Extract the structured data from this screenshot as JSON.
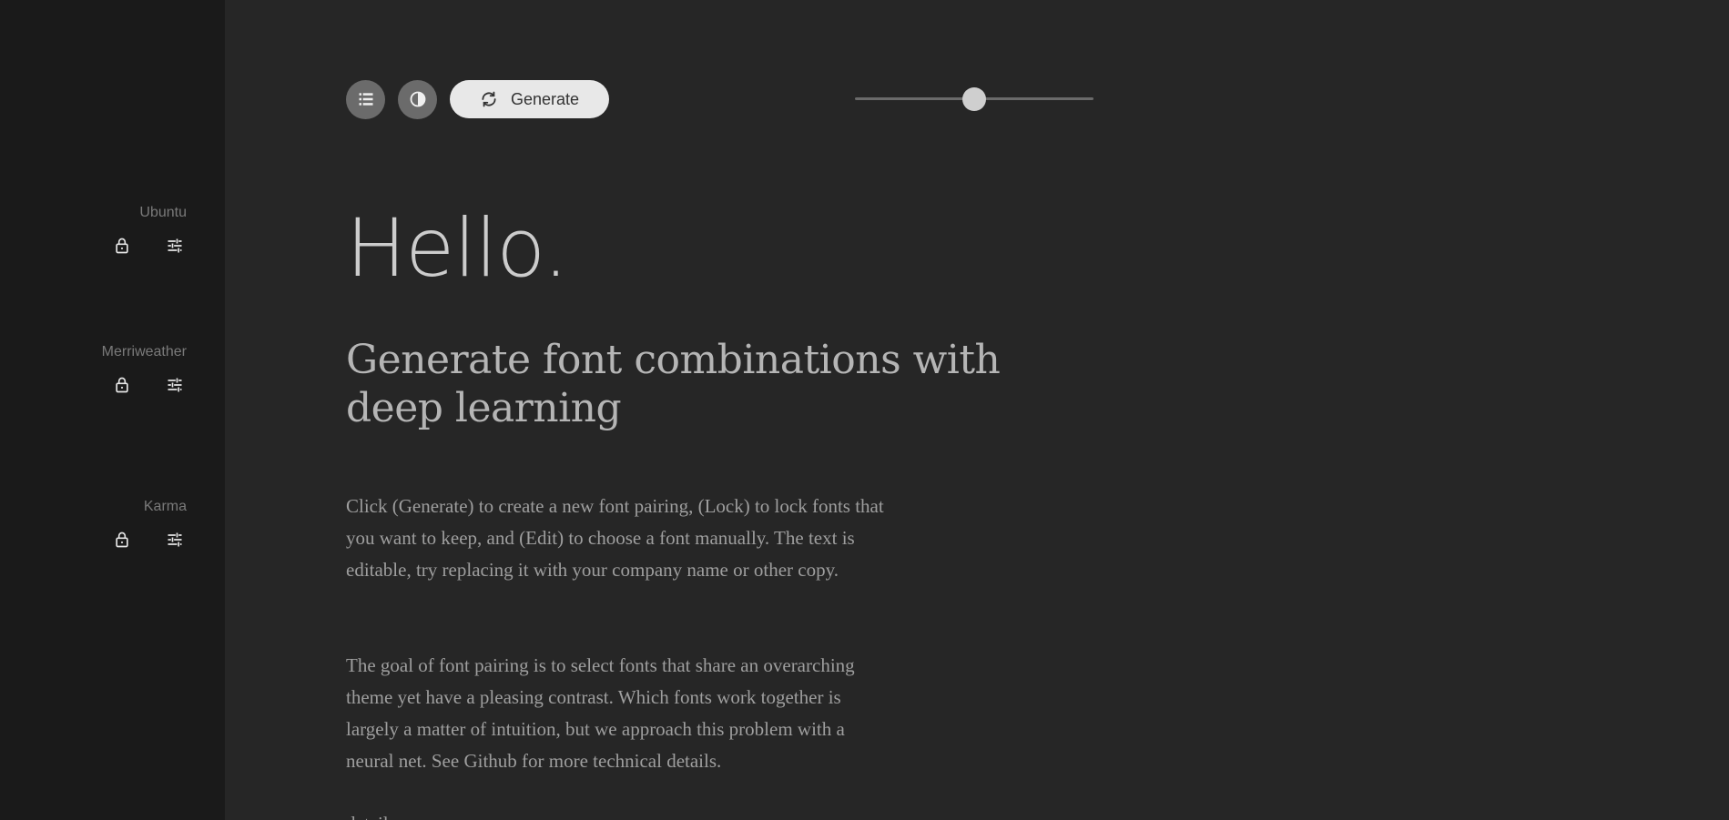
{
  "sidebar": {
    "fonts": [
      {
        "name": "Ubuntu"
      },
      {
        "name": "Merriweather"
      },
      {
        "name": "Karma"
      }
    ],
    "lock_icon": "lock-icon",
    "edit_icon": "sliders-icon"
  },
  "toolbar": {
    "list_icon": "list-icon",
    "contrast_icon": "contrast-icon",
    "generate_label": "Generate",
    "generate_icon": "refresh-icon",
    "slider_value": 0.5
  },
  "content": {
    "heading": "Hello.",
    "subtitle": "Generate font combinations with deep learning",
    "paragraph1": "Click (Generate) to create a new font pairing, (Lock) to lock fonts that you want to keep, and (Edit) to choose a font manually. The text is editable, try replacing it with your company name or other copy.",
    "paragraph2": "The goal of font pairing is to select fonts that share an overarching theme yet have a pleasing contrast. Which fonts work together is largely a matter of intuition, but we approach this problem with a neural net. See Github for more technical details.",
    "overflow_text": "details"
  },
  "colors": {
    "sidebar_bg": "#1a1a1a",
    "main_bg": "#262626",
    "button_bg": "#e8e8e8",
    "circle_button_bg": "#6b6b6b"
  }
}
